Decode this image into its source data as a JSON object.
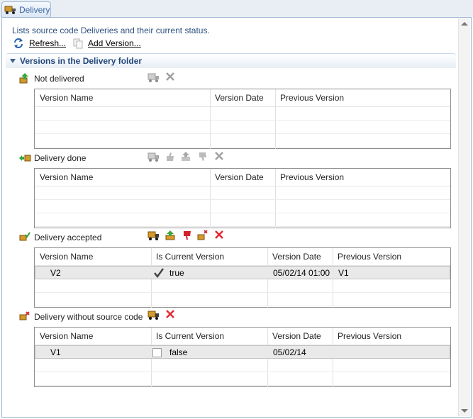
{
  "tab": {
    "label": "Delivery"
  },
  "description": "Lists source code Deliveries and their current status.",
  "actions": {
    "refresh": "Refresh...",
    "add_version": "Add Version..."
  },
  "section": {
    "title": "Versions in the Delivery folder"
  },
  "groups": [
    {
      "label": "Not delivered",
      "columns": [
        "Version Name",
        "Version Date",
        "Previous Version"
      ],
      "rows": []
    },
    {
      "label": "Delivery done",
      "columns": [
        "Version Name",
        "Version Date",
        "Previous Version"
      ],
      "rows": []
    },
    {
      "label": "Delivery accepted",
      "columns": [
        "Version Name",
        "Is Current Version",
        "Version Date",
        "Previous Version"
      ],
      "rows": [
        {
          "name": "V2",
          "current": "true",
          "date": "05/02/14 01:00",
          "previous": "V1"
        }
      ]
    },
    {
      "label": "Delivery without source code",
      "columns": [
        "Version Name",
        "Is Current Version",
        "Version Date",
        "Previous Version"
      ],
      "rows": [
        {
          "name": "V1",
          "current": "false",
          "date": "05/02/14",
          "previous": ""
        }
      ]
    }
  ],
  "icons": {
    "accent": "#3c66a4"
  }
}
